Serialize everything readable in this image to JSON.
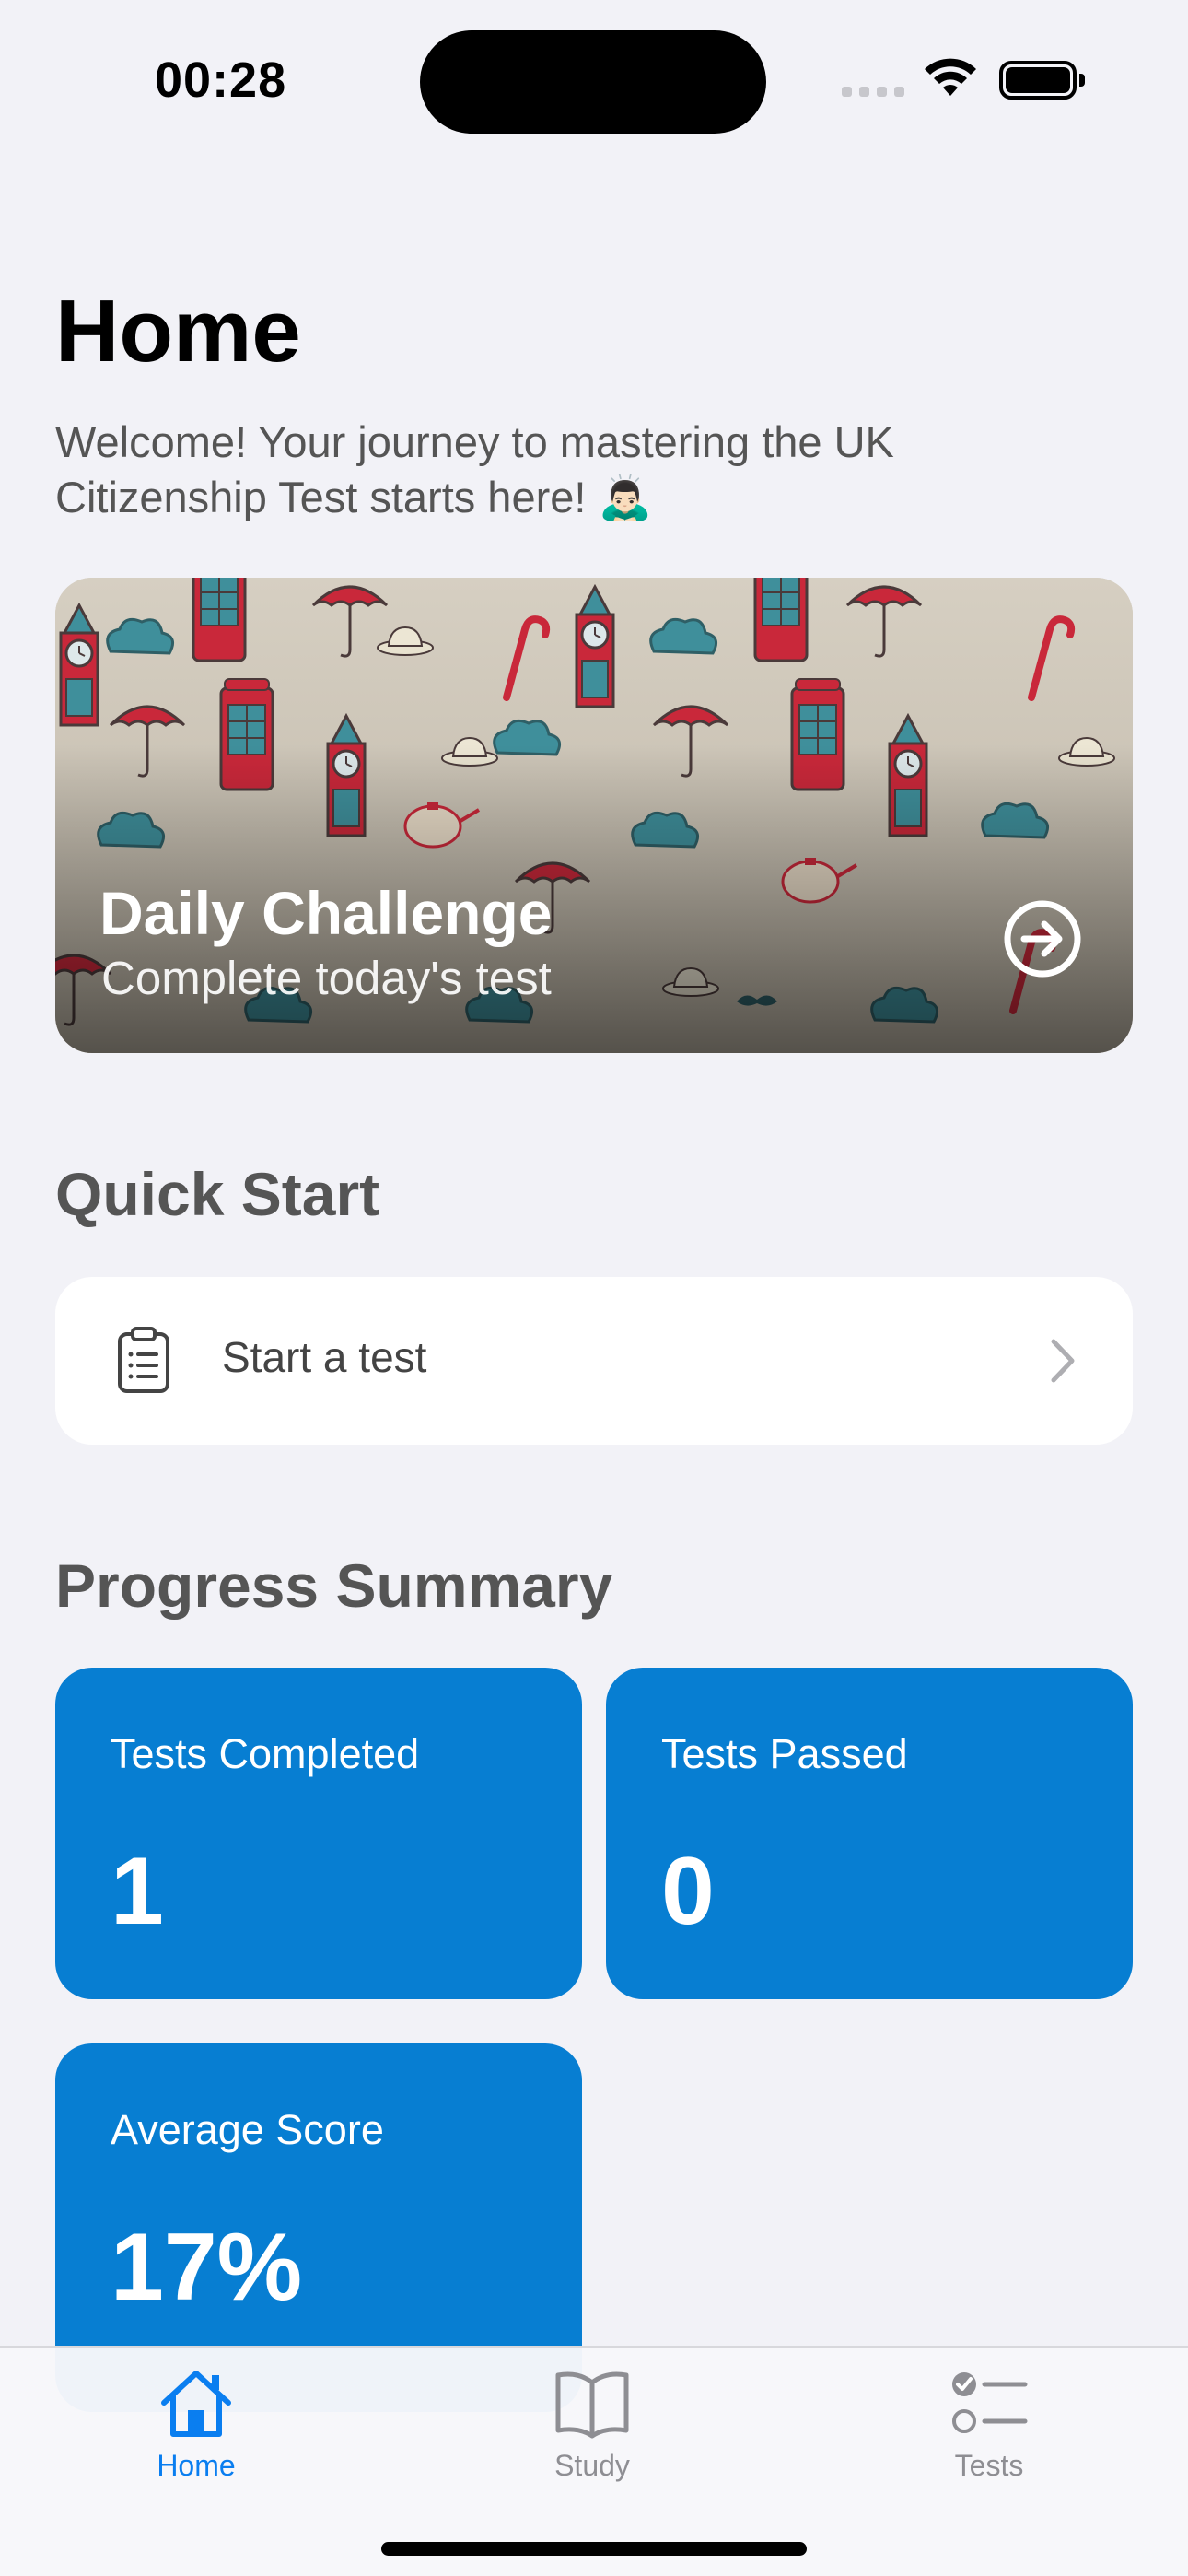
{
  "status_bar": {
    "time": "00:28",
    "icons": [
      "cellular-signal-icon",
      "wifi-icon",
      "battery-icon"
    ]
  },
  "header": {
    "title": "Home",
    "welcome_text": "Welcome! Your journey to mastering the UK Citizenship Test starts here! 🙇🏻‍♂️"
  },
  "daily_challenge": {
    "title": "Daily Challenge",
    "subtitle": "Complete today's test",
    "icon": "arrow-right-circle-icon"
  },
  "quick_start": {
    "section_title": "Quick Start",
    "item_label": "Start a test",
    "item_icon": "clipboard-list-icon"
  },
  "progress_summary": {
    "section_title": "Progress Summary",
    "cards": [
      {
        "label": "Tests Completed",
        "value": "1"
      },
      {
        "label": "Tests Passed",
        "value": "0"
      },
      {
        "label": "Average Score",
        "value": "17%"
      }
    ]
  },
  "tab_bar": {
    "tabs": [
      {
        "label": "Home",
        "icon": "house-icon",
        "active": true
      },
      {
        "label": "Study",
        "icon": "book-icon",
        "active": false
      },
      {
        "label": "Tests",
        "icon": "checklist-icon",
        "active": false
      }
    ]
  },
  "colors": {
    "background": "#f2f2f7",
    "card_blue": "#077ed2",
    "tab_active": "#0a7ef0",
    "tab_inactive": "#8e8e93"
  }
}
